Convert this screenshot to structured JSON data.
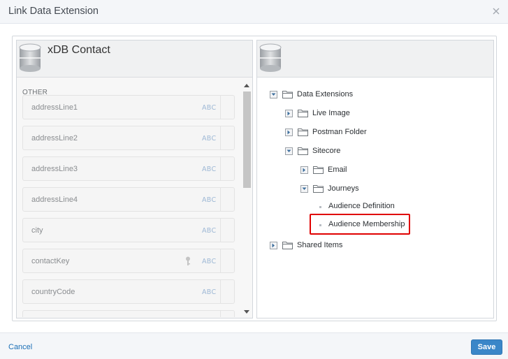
{
  "dialog": {
    "title": "Link Data Extension"
  },
  "left_panel": {
    "title": "xDB Contact",
    "section_label": "OTHER",
    "fields": [
      {
        "name": "addressLine1",
        "type": "ABC",
        "key": false
      },
      {
        "name": "addressLine2",
        "type": "ABC",
        "key": false
      },
      {
        "name": "addressLine3",
        "type": "ABC",
        "key": false
      },
      {
        "name": "addressLine4",
        "type": "ABC",
        "key": false
      },
      {
        "name": "city",
        "type": "ABC",
        "key": false
      },
      {
        "name": "contactKey",
        "type": "ABC",
        "key": true
      },
      {
        "name": "countryCode",
        "type": "ABC",
        "key": false
      },
      {
        "name": "",
        "type": "",
        "key": false
      }
    ]
  },
  "right_panel": {
    "title": "",
    "tree": [
      {
        "label": "Data Extensions",
        "depth": 0,
        "kind": "folder",
        "expanded": true
      },
      {
        "label": "Live Image",
        "depth": 1,
        "kind": "folder",
        "expanded": false
      },
      {
        "label": "Postman Folder",
        "depth": 1,
        "kind": "folder",
        "expanded": false
      },
      {
        "label": "Sitecore",
        "depth": 1,
        "kind": "folder",
        "expanded": true
      },
      {
        "label": "Email",
        "depth": 2,
        "kind": "folder",
        "expanded": false
      },
      {
        "label": "Journeys",
        "depth": 2,
        "kind": "folder",
        "expanded": true
      },
      {
        "label": "Audience Definition",
        "depth": 3,
        "kind": "leaf",
        "selected": false
      },
      {
        "label": "Audience Membership",
        "depth": 3,
        "kind": "leaf",
        "selected": true
      },
      {
        "label": "Shared Items",
        "depth": 0,
        "kind": "folder",
        "expanded": false
      }
    ]
  },
  "footer": {
    "cancel_label": "Cancel",
    "save_label": "Save"
  },
  "colors": {
    "accent": "#3a86c8",
    "link": "#1b6fb6",
    "highlight": "#e00000",
    "type_badge": "#9db8d5"
  },
  "icons": [
    "close-icon",
    "database-icon",
    "key-icon",
    "folder-icon",
    "expand-icon",
    "collapse-icon",
    "scroll-up-icon",
    "scroll-down-icon"
  ]
}
